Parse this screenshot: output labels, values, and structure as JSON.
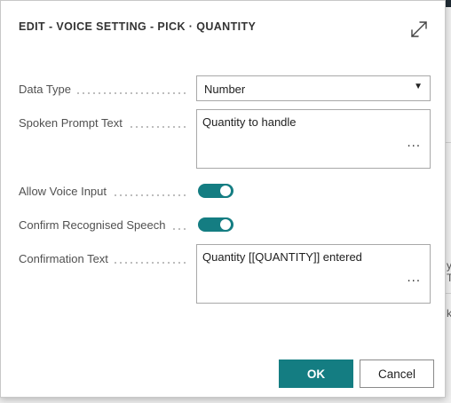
{
  "dialog": {
    "title": "EDIT - VOICE SETTING - PICK · QUANTITY",
    "expand_icon": "expand-diagonal-arrows"
  },
  "fields": {
    "data_type": {
      "label": "Data Type",
      "value": "Number"
    },
    "spoken_prompt": {
      "label": "Spoken Prompt Text",
      "value": "Quantity to handle"
    },
    "allow_voice_input": {
      "label": "Allow Voice Input",
      "state": "on"
    },
    "confirm_speech": {
      "label": "Confirm Recognised Speech",
      "state": "on"
    },
    "confirmation_text": {
      "label": "Confirmation Text",
      "value": "Quantity [[QUANTITY]] entered"
    }
  },
  "ellipsis": "...",
  "buttons": {
    "ok": "OK",
    "cancel": "Cancel"
  },
  "background": {
    "glyph_1": "y",
    "glyph_2": "T",
    "glyph_3": "k"
  },
  "colors": {
    "accent": "#147d82",
    "field_border": "#a8a8a8",
    "label": "#505050"
  }
}
